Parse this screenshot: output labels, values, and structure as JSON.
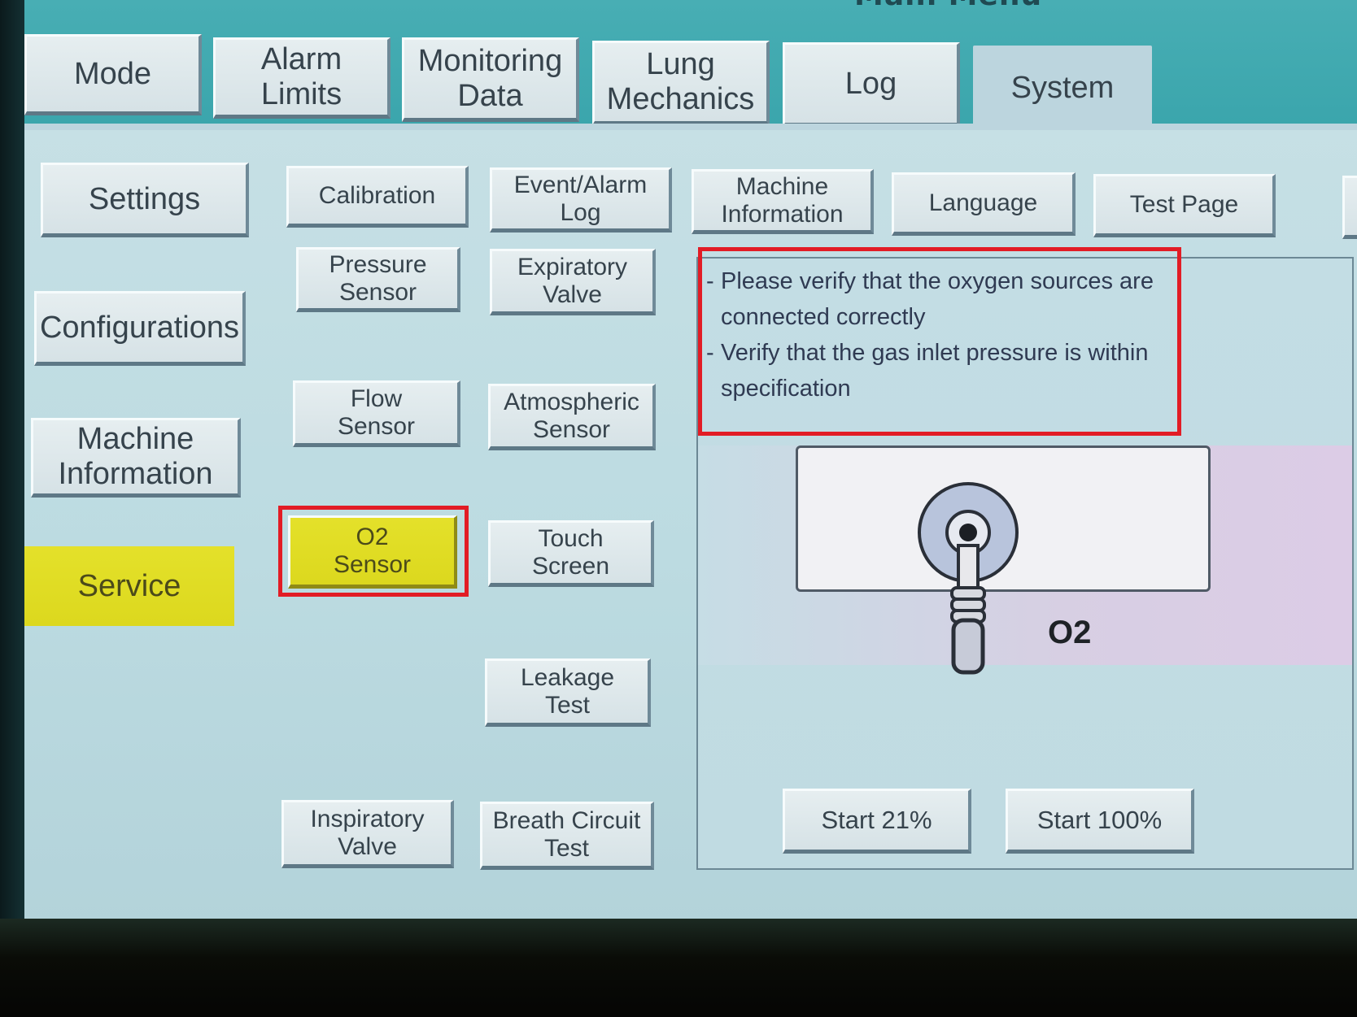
{
  "header": {
    "title": "Main Menu"
  },
  "tabs": [
    {
      "id": "mode",
      "label": "Mode"
    },
    {
      "id": "alarm-limits",
      "label": "Alarm\nLimits"
    },
    {
      "id": "monitoring-data",
      "label": "Monitoring\nData"
    },
    {
      "id": "lung-mechanics",
      "label": "Lung\nMechanics"
    },
    {
      "id": "log",
      "label": "Log"
    },
    {
      "id": "system",
      "label": "System",
      "active": true
    }
  ],
  "sidebar": {
    "items": [
      {
        "label": "Settings"
      },
      {
        "label": "Configurations"
      },
      {
        "label": "Machine\nInformation"
      },
      {
        "label": "Service",
        "selected": true
      }
    ]
  },
  "service_tabs": [
    {
      "label": "Calibration"
    },
    {
      "label": "Event/Alarm\nLog"
    },
    {
      "label": "Machine\nInformation"
    },
    {
      "label": "Language"
    },
    {
      "label": "Test Page"
    }
  ],
  "sensor_buttons": {
    "pressure_sensor": "Pressure\nSensor",
    "expiratory_valve": "Expiratory\nValve",
    "flow_sensor": "Flow\nSensor",
    "atmospheric_sensor": "Atmospheric\nSensor",
    "o2_sensor": "O2\nSensor",
    "touch_screen": "Touch\nScreen",
    "leakage_test": "Leakage\nTest",
    "inspiratory_valve": "Inspiratory\nValve",
    "breath_circuit_test": "Breath Circuit\nTest"
  },
  "instructions": {
    "line1": "Please verify that the oxygen sources are connected correctly",
    "line2": "Verify that the gas inlet pressure is within specification"
  },
  "illustration": {
    "label": "O2",
    "icon": "oxygen-connector-icon"
  },
  "actions": {
    "start_21": "Start 21%",
    "start_100": "Start 100%"
  },
  "colors": {
    "header_teal": "#3aa5ac",
    "screen_bg": "#c9e1e6",
    "selected_yellow": "#dcd81e",
    "highlight_red": "#e21c25"
  }
}
